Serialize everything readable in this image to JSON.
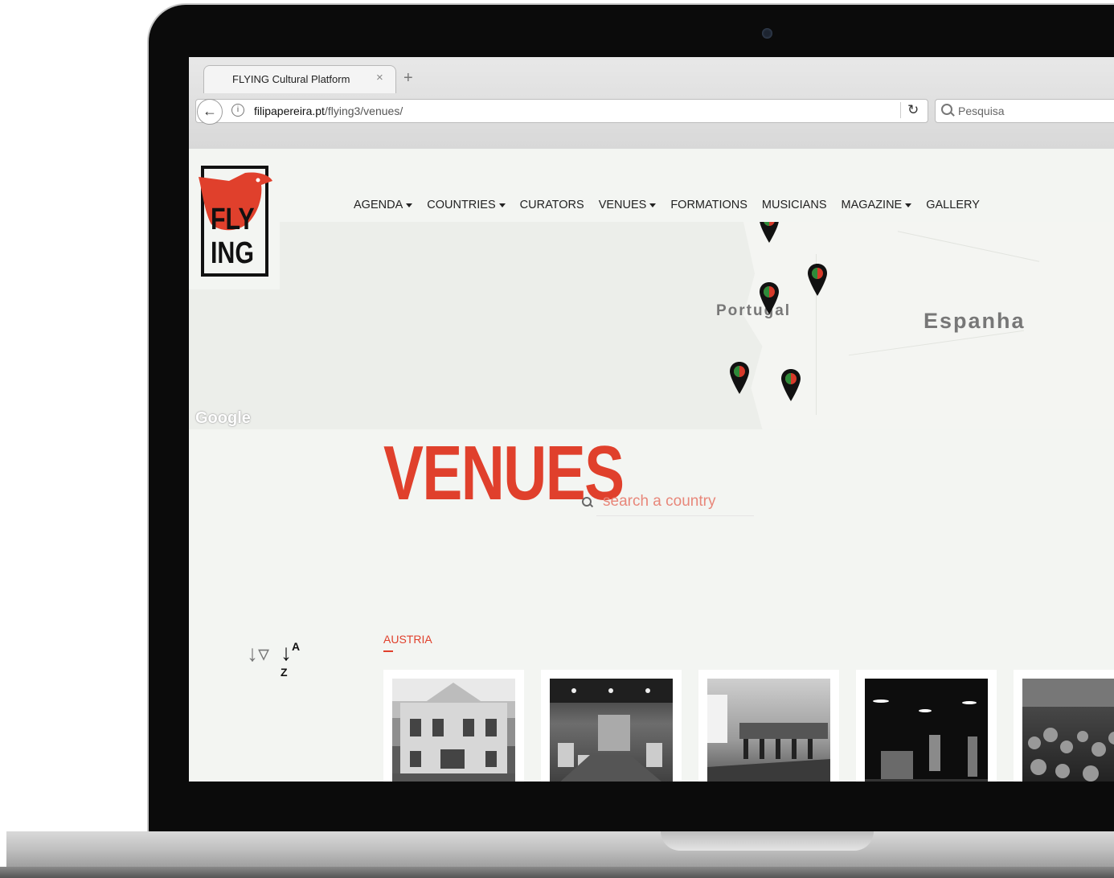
{
  "browser": {
    "tab_title": "FLYING Cultural Platform",
    "tab_close": "×",
    "new_tab": "+",
    "url_host": "filipapereira.pt",
    "url_path": "/flying3/venues/",
    "search_placeholder": "Pesquisa"
  },
  "logo": {
    "line1": "FLY",
    "line2": "ING"
  },
  "nav": {
    "items": [
      {
        "label": "AGENDA",
        "dropdown": true
      },
      {
        "label": "COUNTRIES",
        "dropdown": true
      },
      {
        "label": "CURATORS",
        "dropdown": false
      },
      {
        "label": "VENUES",
        "dropdown": true
      },
      {
        "label": "FORMATIONS",
        "dropdown": false
      },
      {
        "label": "MUSICIANS",
        "dropdown": false
      },
      {
        "label": "MAGAZINE",
        "dropdown": true
      },
      {
        "label": "GALLERY",
        "dropdown": false
      }
    ]
  },
  "map": {
    "label_portugal": "Portugal",
    "label_spain": "Espanha",
    "attribution": "Google",
    "pin_count": 5
  },
  "page": {
    "title": "VENUES",
    "search_placeholder": "search a country",
    "country_heading": "AUSTRIA"
  },
  "colors": {
    "accent": "#e0402c",
    "background": "#f3f5f2"
  },
  "venues": [
    {
      "photo": "building-facade"
    },
    {
      "photo": "cafe-interior"
    },
    {
      "photo": "bar-interior"
    },
    {
      "photo": "concert-stage"
    },
    {
      "photo": "crowded-hall"
    }
  ]
}
